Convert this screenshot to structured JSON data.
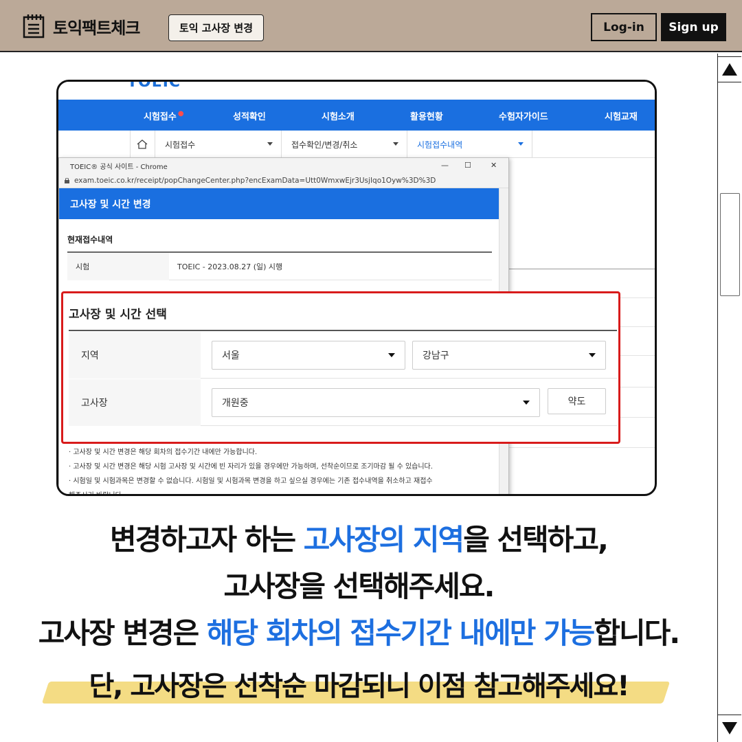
{
  "header": {
    "brand_name": "토익팩트체크",
    "change_button": "토익 고사장 변경",
    "login_button": "Log-in",
    "signup_button": "Sign up",
    "bar_color": "#bba998"
  },
  "screenshot": {
    "site_logo": "TOEIC",
    "nav": [
      "시험접수",
      "성적확인",
      "시험소개",
      "활용현황",
      "수험자가이드",
      "시험교재"
    ],
    "sub_nav": [
      "시험접수",
      "접수확인/변경/취소",
      "시험접수내역"
    ],
    "popup": {
      "window_title": "TOEIC® 공식 사이트 - Chrome",
      "window_controls": [
        "—",
        "☐",
        "✕"
      ],
      "url": "exam.toeic.co.kr/receipt/popChangeCenter.php?encExamData=Utt0WmxwEjr3UsjIqo1Oyw%3D%3D",
      "header": "고사장 및 시간 변경",
      "current_title": "현재접수내역",
      "current_row": {
        "label": "시험",
        "value": "TOEIC - 2023.08.27 (일) 시행"
      },
      "notes": [
        "· 고사장 및 시간 변경은 해당 회차의 접수기간 내에만 가능합니다.",
        "· 고사장 및 시간 변경은 해당 시험 고사장 및 시간에 빈 자리가 있을 경우에만 가능하며, 선착순이므로 조기마감 될 수 있습니다.",
        "· 시험일 및 시험과목은 변경할 수 없습니다. 시험일 및 시험과목 변경을 하고 싶으실 경우에는 기존 접수내역을 취소하고 재접수",
        "  해주시기 바랍니다."
      ]
    },
    "selection": {
      "title": "고사장 및 시간 선택",
      "region_label": "지역",
      "region_value": "서울",
      "district_value": "강남구",
      "center_label": "고사장",
      "center_value": "개원중",
      "map_button": "약도",
      "highlight_color": "#d81b1b"
    }
  },
  "captions": {
    "line1_a": "변경하고자 하는 ",
    "line1_b": "고사장의 지역",
    "line1_c": "을 선택하고,",
    "line2": "고사장을 선택해주세요.",
    "line3_a": "고사장 변경은 ",
    "line3_b": "해당 회차의 접수기간 내에만 가능",
    "line3_c": "합니다.",
    "line4": "단, 고사장은 선착순 마감되니 이점 참고해주세요!",
    "accent_color": "#1d6fe0",
    "highlight_color": "#f4dc84"
  }
}
